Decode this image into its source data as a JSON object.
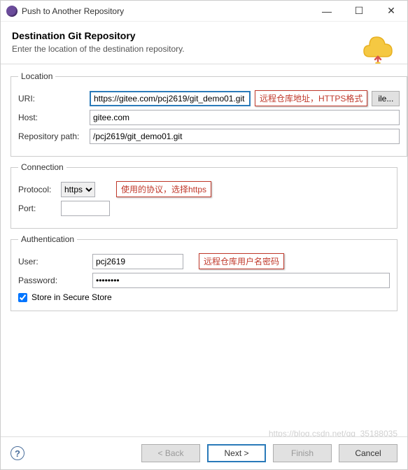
{
  "window": {
    "title": "Push to Another Repository",
    "minimize": "—",
    "maximize": "☐",
    "close": "✕"
  },
  "header": {
    "title": "Destination Git Repository",
    "subtitle": "Enter the location of the destination repository."
  },
  "location": {
    "legend": "Location",
    "uri_label": "URI:",
    "uri_value": "https://gitee.com/pcj2619/git_demo01.git",
    "annot_uri": "远程仓库地址，HTTPS格式",
    "file_button": "ile...",
    "host_label": "Host:",
    "host_value": "gitee.com",
    "repo_label": "Repository path:",
    "repo_value": "/pcj2619/git_demo01.git"
  },
  "connection": {
    "legend": "Connection",
    "protocol_label": "Protocol:",
    "protocol_value": "https",
    "annot_protocol": "使用的协议，选择https",
    "port_label": "Port:",
    "port_value": ""
  },
  "auth": {
    "legend": "Authentication",
    "user_label": "User:",
    "user_value": "pcj2619",
    "annot_auth": "远程仓库用户名密码",
    "password_label": "Password:",
    "password_value": "••••••••",
    "store_label": "Store in Secure Store"
  },
  "footer": {
    "back": "< Back",
    "next": "Next >",
    "finish": "Finish",
    "cancel": "Cancel"
  },
  "watermark": "https://blog.csdn.net/qq_35188035"
}
